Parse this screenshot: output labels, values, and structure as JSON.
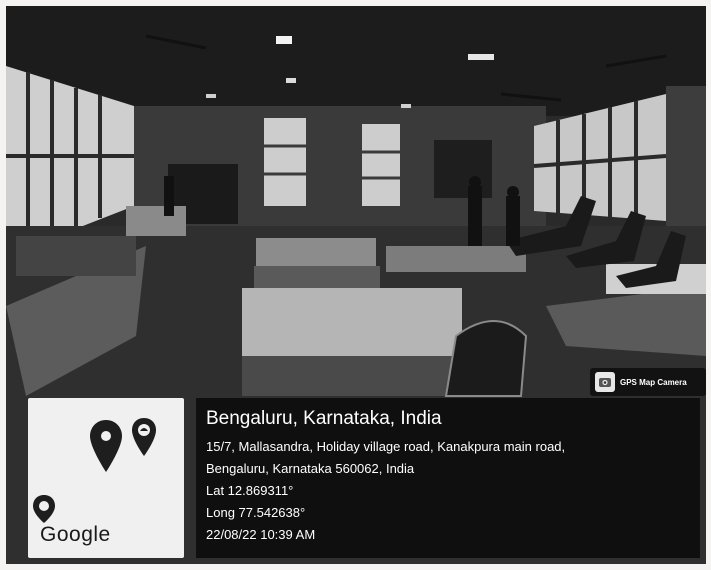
{
  "location": {
    "city": "Bengaluru, Karnataka, India",
    "address_line1": "15/7, Mallasandra, Holiday village road, Kanakpura main road,",
    "address_line2": "Bengaluru, Karnataka 560062, India",
    "latitude": "Lat 12.869311°",
    "longitude": "Long 77.542638°",
    "datetime": "22/08/22 10:39 AM"
  },
  "badge": {
    "label": "GPS Map Camera",
    "icon": "camera-icon"
  },
  "map": {
    "brand": "Google",
    "pin_icon": "map-pin-icon"
  },
  "colors": {
    "overlay": "#0f0f0f",
    "text": "#ffffff",
    "map_bg": "#f0f0f0"
  }
}
